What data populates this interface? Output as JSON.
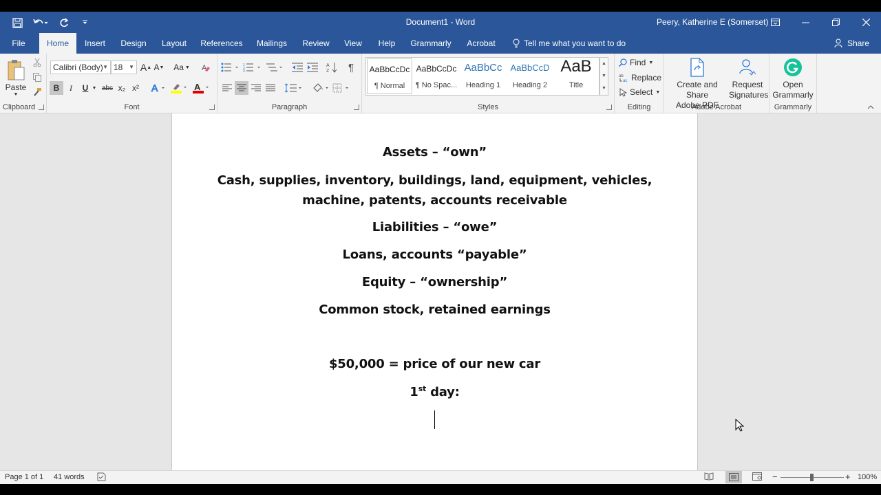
{
  "window": {
    "title": "Document1  -  Word",
    "user": "Peery, Katherine E (Somerset)"
  },
  "tabs": [
    {
      "label": "File"
    },
    {
      "label": "Home"
    },
    {
      "label": "Insert"
    },
    {
      "label": "Design"
    },
    {
      "label": "Layout"
    },
    {
      "label": "References"
    },
    {
      "label": "Mailings"
    },
    {
      "label": "Review"
    },
    {
      "label": "View"
    },
    {
      "label": "Help"
    },
    {
      "label": "Grammarly"
    },
    {
      "label": "Acrobat"
    }
  ],
  "tellme": "Tell me what you want to do",
  "share": "Share",
  "ribbon": {
    "clipboard": {
      "paste": "Paste",
      "label": "Clipboard"
    },
    "font": {
      "name": "Calibri (Body)",
      "size": "18",
      "label": "Font",
      "case_btn": "Aa",
      "bold": "B",
      "italic": "I",
      "underline": "U",
      "strike": "abc",
      "sub": "x₂",
      "sup": "x²",
      "grow": "A",
      "shrink": "A"
    },
    "paragraph": {
      "label": "Paragraph"
    },
    "styles": {
      "label": "Styles",
      "items": [
        {
          "preview": "AaBbCcDc",
          "name": "¶ Normal"
        },
        {
          "preview": "AaBbCcDc",
          "name": "¶ No Spac..."
        },
        {
          "preview": "AaBbCc",
          "name": "Heading 1"
        },
        {
          "preview": "AaBbCcD",
          "name": "Heading 2"
        },
        {
          "preview": "AaB",
          "name": "Title"
        }
      ]
    },
    "editing": {
      "find": "Find",
      "replace": "Replace",
      "select": "Select",
      "label": "Editing"
    },
    "acrobat": {
      "create_line1": "Create and Share",
      "create_line2": "Adobe PDF",
      "request_line1": "Request",
      "request_line2": "Signatures",
      "label": "Adobe Acrobat"
    },
    "grammarly": {
      "open_line1": "Open",
      "open_line2": "Grammarly",
      "label": "Grammarly"
    }
  },
  "document": {
    "lines": [
      "Assets – “own”",
      "Cash, supplies, inventory, buildings, land, equipment, vehicles,",
      "machine, patents, accounts receivable",
      "Liabilities – “owe”",
      "Loans, accounts “payable”",
      "Equity – “ownership”",
      "Common stock, retained earnings",
      "$50,000 = price of our new car"
    ],
    "day_number": "1",
    "day_sup": "st",
    "day_rest": " day:"
  },
  "status": {
    "page": "Page 1 of 1",
    "words": "41 words",
    "zoom": "100%"
  },
  "colors": {
    "titlebar": "#2b579a",
    "ribbon": "#f3f3f3",
    "workspace": "#e6e6e6",
    "grammarly": "#15c39a"
  }
}
